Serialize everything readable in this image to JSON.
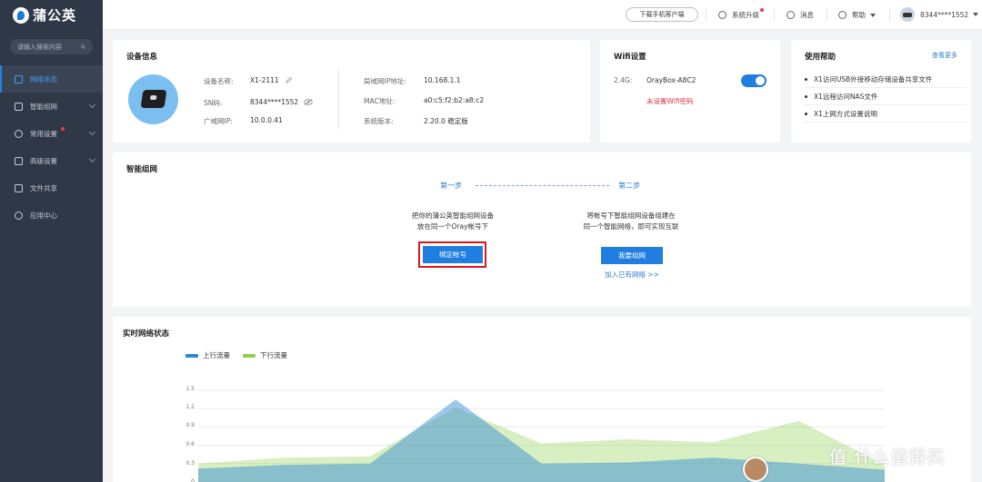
{
  "app": {
    "name": "蒲公英"
  },
  "sidebar": {
    "search_placeholder": "请输入搜索内容",
    "items": [
      {
        "label": "网络状态",
        "active": true
      },
      {
        "label": "智能组网",
        "has_submenu": true
      },
      {
        "label": "常用设置",
        "has_submenu": true,
        "badge": "red-dot"
      },
      {
        "label": "高级设置",
        "has_submenu": true
      },
      {
        "label": "文件共享"
      },
      {
        "label": "应用中心"
      }
    ]
  },
  "topbar": {
    "download": "下载手机客户端",
    "upgrade": "系统升级",
    "messages": "消息",
    "help": "帮助",
    "user": "8344****1552"
  },
  "device": {
    "title": "设备信息",
    "name_label": "设备名称:",
    "name": "X1-2111",
    "sn_label": "SN码:",
    "sn": "8344****1552",
    "wan_label": "广域网IP:",
    "wan": "10.0.0.41",
    "lan_label": "局域网IP地址:",
    "lan": "10.168.1.1",
    "mac_label": "MAC地址:",
    "mac": "a0:c5:f2:b2:a8:c2",
    "ver_label": "系统版本:",
    "ver": "2.20.0 稳定版"
  },
  "wifi": {
    "title": "Wifi设置",
    "band": "2.4G:",
    "ssid": "OrayBox-A8C2",
    "enabled": true,
    "warning": "未设置Wifi密码",
    "warning_color": "#e0334a"
  },
  "help": {
    "title": "使用帮助",
    "more": "查看更多",
    "items": [
      "X1访问USB外接移动存储设备共享文件",
      "X1远程访问NAS文件",
      "X1上网方式设置说明"
    ]
  },
  "mesh": {
    "title": "智能组网",
    "step1": "第一步",
    "step2": "第二步",
    "step1_text1": "把你的蒲公英智能组网设备",
    "step1_text2": "放在同一个Oray帐号下",
    "step2_text1": "将帐号下智能组网设备组建在",
    "step2_text2": "同一个智能网络，即可实现互联",
    "bind_button": "绑定帐号",
    "join_button": "我要组网",
    "existing_link": "加入已有网络 >>"
  },
  "realtime": {
    "title": "实时网络状态",
    "legend_up": "上行流量",
    "legend_down": "下行流量"
  },
  "chart_data": {
    "type": "area",
    "title": "",
    "ylim": [
      0,
      1.5
    ],
    "yticks": [
      "1.5",
      "1.2",
      "0.9",
      "0.6",
      "0.3",
      "0"
    ],
    "series": [
      {
        "name": "上行流量",
        "color": "#2a86d8",
        "values": [
          0.22,
          0.28,
          0.3,
          1.35,
          0.3,
          0.32,
          0.4,
          0.3,
          0.2
        ]
      },
      {
        "name": "下行流量",
        "color": "#8fd14f",
        "values": [
          0.3,
          0.4,
          0.42,
          1.22,
          0.63,
          0.7,
          0.65,
          1.0,
          0.28
        ]
      }
    ]
  },
  "watermark": "值 什么值得买",
  "colors": {
    "accent": "#1f7ee0",
    "sidebar_bg": "#2f3846",
    "highlight": "#e0151d"
  }
}
